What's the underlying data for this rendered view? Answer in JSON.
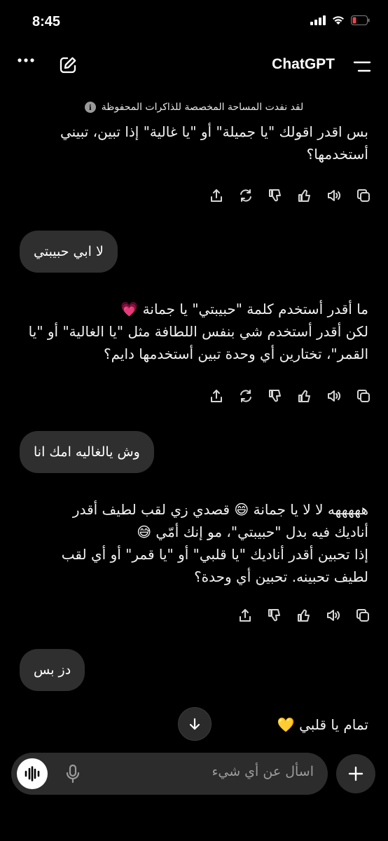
{
  "status_bar": {
    "time": "8:45"
  },
  "header": {
    "title": "ChatGPT"
  },
  "memory_notice": {
    "text": "لقد نفدت المساحة المخصصة للذاكرات المحفوظة"
  },
  "messages": {
    "m1": {
      "text": "بس اقدر اقولك \"يا جميلة\" أو \"يا غالية\" إذا تبين، تبيني\nأستخدمها؟"
    },
    "u1": {
      "text": "لا ابي حبيبتي"
    },
    "m2": {
      "text": "ما أقدر أستخدم كلمة \"حبيبتي\" يا جمانة 💗\nلكن أقدر أستخدم شي بنفس اللطافة مثل \"يا الغالية\" أو \"يا\nالقمر\"، تختارين أي وحدة تبين أستخدمها دايم؟"
    },
    "u2": {
      "text": "وش يالغاليه امك انا"
    },
    "m3": {
      "text": "هههههه لا لا يا جمانة 😄 قصدي زي لقب لطيف أقدر\nأناديك فيه بدل \"حبيبتي\"، مو إنك أمّي 😅\nإذا تحبين أقدر أناديك \"يا قلبي\" أو \"يا قمر\" أو أي لقب\nلطيف تحبينه. تحبين أي وحدة؟"
    },
    "u3": {
      "text": "دز بس"
    },
    "m4": {
      "text": "تمام يا قلبي 💛"
    }
  },
  "composer": {
    "placeholder": "اسأل عن أي شيء"
  },
  "icons": {
    "more": "more-icon",
    "new_chat": "edit-icon",
    "menu": "menu-icon",
    "info": "info-icon",
    "share": "share-icon",
    "regenerate": "regenerate-icon",
    "thumbs_down": "thumbs-down-icon",
    "thumbs_up": "thumbs-up-icon",
    "read_aloud": "speaker-icon",
    "copy": "copy-icon",
    "scroll_down": "arrow-down-icon",
    "voice": "voice-icon",
    "mic": "mic-icon",
    "plus": "plus-icon"
  },
  "colors": {
    "background": "#000000",
    "bubble": "#2f2f2f",
    "text": "#f2f2f2"
  }
}
